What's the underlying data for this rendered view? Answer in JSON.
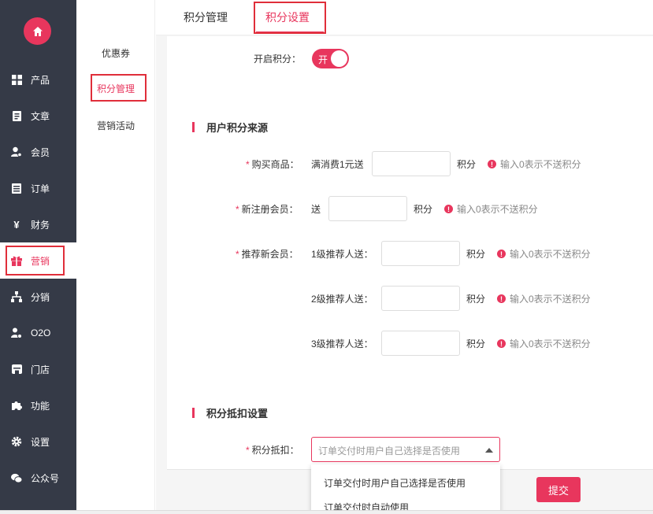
{
  "colors": {
    "accent": "#e8365d",
    "sidebar_bg": "#353a47",
    "highlight": "#e02e3a"
  },
  "sidebar": {
    "items": [
      {
        "label": "产品",
        "icon": "grid-icon"
      },
      {
        "label": "文章",
        "icon": "document-icon"
      },
      {
        "label": "会员",
        "icon": "user-icon"
      },
      {
        "label": "订单",
        "icon": "list-icon"
      },
      {
        "label": "财务",
        "icon": "yen-icon"
      },
      {
        "label": "营销",
        "icon": "gift-icon"
      },
      {
        "label": "分销",
        "icon": "hierarchy-icon"
      },
      {
        "label": "O2O",
        "icon": "user-gear-icon"
      },
      {
        "label": "门店",
        "icon": "store-icon"
      },
      {
        "label": "功能",
        "icon": "puzzle-icon"
      },
      {
        "label": "设置",
        "icon": "gear-icon"
      },
      {
        "label": "公众号",
        "icon": "wechat-icon"
      }
    ],
    "active": "营销"
  },
  "subnav": {
    "items": [
      "优惠券",
      "积分管理",
      "营销活动"
    ],
    "active": "积分管理"
  },
  "tabs": {
    "items": [
      "积分管理",
      "积分设置"
    ],
    "active": "积分设置"
  },
  "form": {
    "enable_label": "开启积分：",
    "toggle_text": "开",
    "section1_title": "用户积分来源",
    "purchase_label": "购买商品：",
    "purchase_prefix": "满消费1元送",
    "register_label": "新注册会员：",
    "register_prefix": "送",
    "refer_label": "推荐新会员：",
    "refer_level1": "1级推荐人送：",
    "refer_level2": "2级推荐人送：",
    "refer_level3": "3级推荐人送：",
    "unit": "积分",
    "hint": "输入0表示不送积分",
    "section2_title": "积分抵扣设置",
    "deduct_label": "积分抵扣：",
    "deduct_placeholder": "订单交付时用户自己选择是否使用",
    "deduct_options": [
      "订单交付时用户自己选择是否使用",
      "订单交付时自动使用"
    ]
  },
  "footer": {
    "submit_label": "提交"
  }
}
